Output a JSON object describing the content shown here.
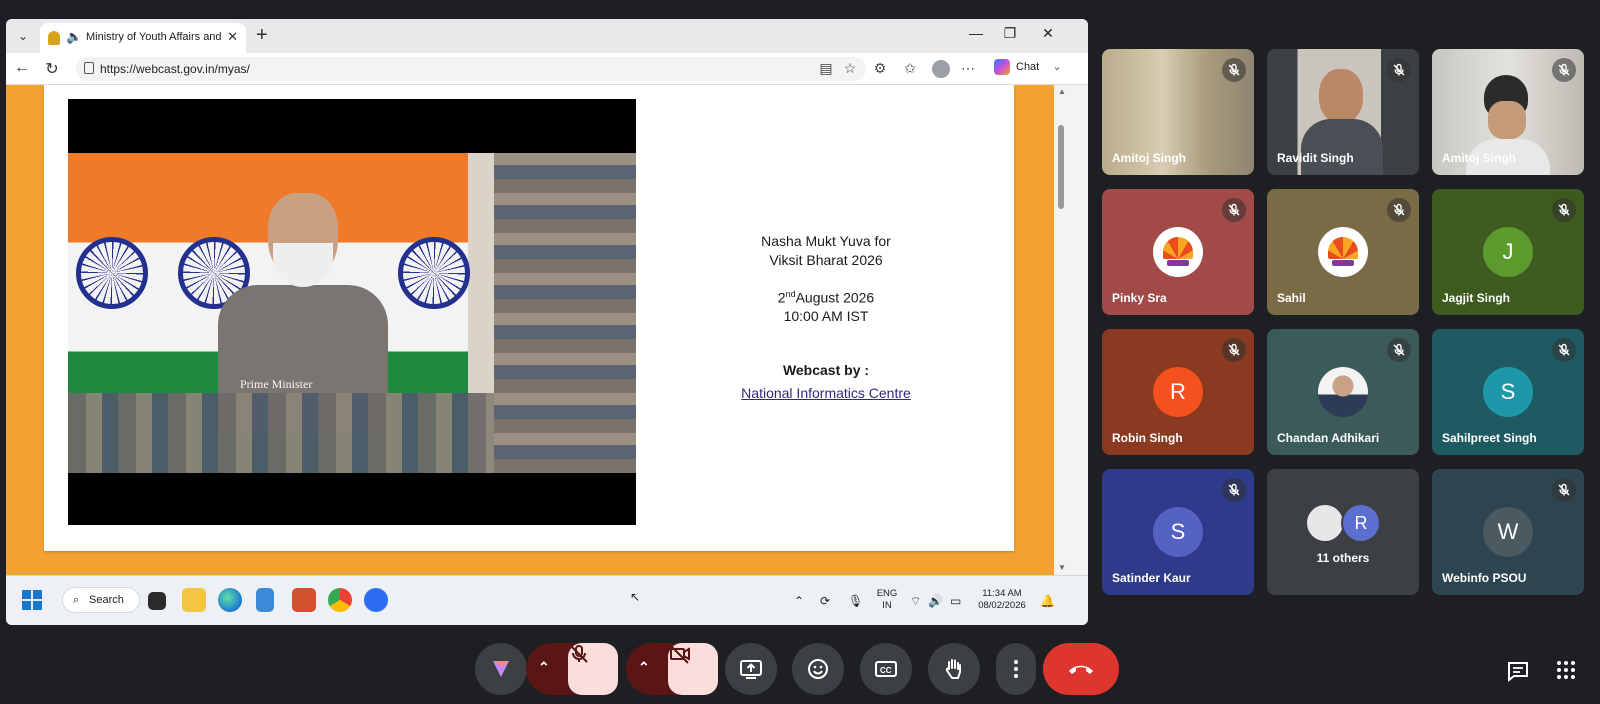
{
  "browser": {
    "tab_title": "Ministry of Youth Affairs and",
    "url": "https://webcast.gov.in/myas/",
    "chat_label": "Chat"
  },
  "slide": {
    "video_caption": "Prime Minister",
    "event_title_line1": "Nasha Mukt Yuva for",
    "event_title_line2": "Viksit Bharat 2026",
    "date_day": "2",
    "date_suffix": "nd",
    "date_rest": "August 2026",
    "time": "10:00 AM IST",
    "webcast_label": "Webcast by :",
    "webcast_org": "National Informatics Centre"
  },
  "taskbar": {
    "search_label": "Search",
    "lang_line1": "ENG",
    "lang_line2": "IN",
    "clock_time": "11:34 AM",
    "clock_date": "08/02/2026"
  },
  "participants": [
    {
      "name": "Amitoj Singh",
      "avatar": "",
      "type": "camera"
    },
    {
      "name": "Ravidit Singh",
      "avatar": "",
      "type": "camera"
    },
    {
      "name": "Amitoj Singh",
      "avatar": "",
      "type": "camera"
    },
    {
      "name": "Pinky Sra",
      "avatar": "",
      "type": "logo",
      "color": "#a14a48"
    },
    {
      "name": "Sahil",
      "avatar": "",
      "type": "logo",
      "color": "#7a6a45"
    },
    {
      "name": "Jagjit Singh",
      "avatar": "J",
      "type": "letter",
      "color": "#3d5a1f",
      "avatar_color": "#5b9a2d"
    },
    {
      "name": "Robin Singh",
      "avatar": "R",
      "type": "letter",
      "color": "#8a3a20",
      "avatar_color": "#f4511e"
    },
    {
      "name": "Chandan Adhikari",
      "avatar": "",
      "type": "photo",
      "color": "#3b5a5a"
    },
    {
      "name": "Sahilpreet Singh",
      "avatar": "S",
      "type": "letter",
      "color": "#1f5a62",
      "avatar_color": "#1e98a8"
    },
    {
      "name": "Satinder Kaur",
      "avatar": "S",
      "type": "letter",
      "color": "#2e3a8a",
      "avatar_color": "#5562c4"
    },
    {
      "name": "11 others",
      "avatar": "R",
      "type": "others",
      "color": "#3c4043"
    },
    {
      "name": "Webinfo PSOU",
      "avatar": "W",
      "type": "letter",
      "color": "#2c4550",
      "avatar_color": "#4a5a60"
    }
  ],
  "colors": {
    "meet_bg": "#1e1f22",
    "end_call": "#dc362e",
    "mic_off_bg": "#5a1515",
    "mic_off_btn": "#f9dedc",
    "page_orange": "#f2a132"
  }
}
